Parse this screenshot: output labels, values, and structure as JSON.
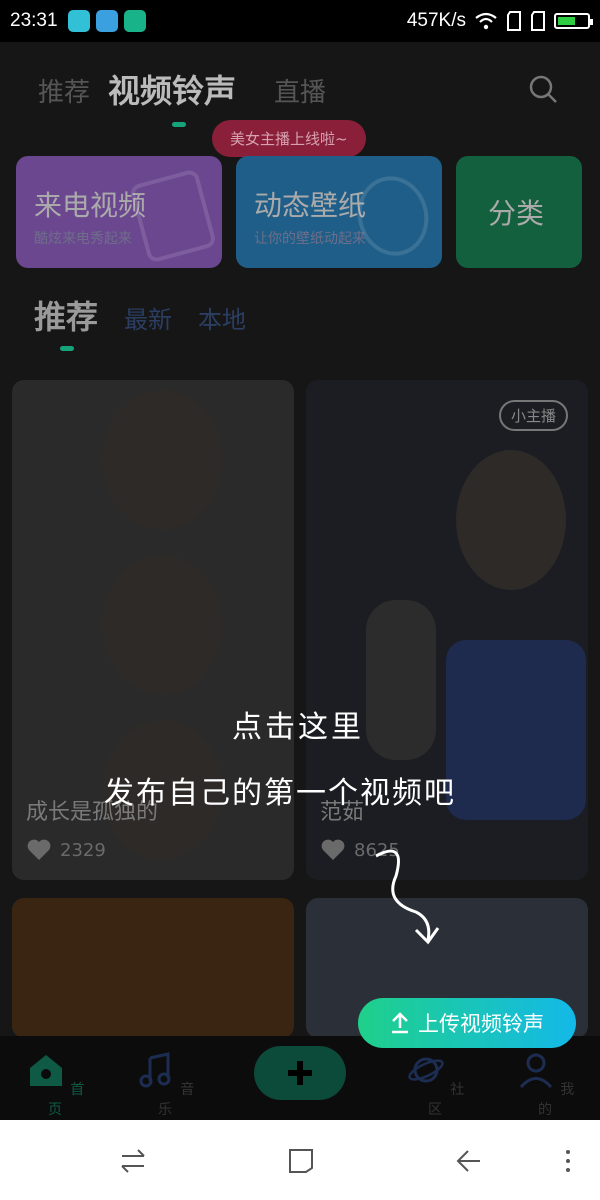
{
  "status_bar": {
    "time": "23:31",
    "network_speed": "457K/s",
    "battery_level": 0.6
  },
  "top_nav": {
    "tabs": [
      "推荐",
      "视频铃声",
      "直播"
    ],
    "active_tab": "视频铃声",
    "tooltip": "美女主播上线啦~"
  },
  "feature_cards": [
    {
      "title": "来电视频",
      "subtitle": "酷炫来电秀起来",
      "color": "#a06ad6"
    },
    {
      "title": "动态壁纸",
      "subtitle": "让你的壁纸动起来",
      "color": "#2a96d8"
    },
    {
      "title": "分类",
      "subtitle": "",
      "color": "#1ea36e"
    }
  ],
  "sub_tabs": [
    "推荐",
    "最新",
    "本地"
  ],
  "videos": [
    {
      "title": "成长是孤独的",
      "likes": "2329",
      "badge": ""
    },
    {
      "title": "范茹",
      "likes": "8625",
      "badge": "小主播"
    }
  ],
  "guide": {
    "line1": "点击这里",
    "line2": "发布自己的第一个视频吧"
  },
  "upload_button": "上传视频铃声",
  "bottom_nav": [
    "首页",
    "音乐",
    "社区",
    "我的"
  ],
  "colors": {
    "accent": "#16a37a",
    "upload_start": "#1fd08a",
    "upload_end": "#14b9e8"
  }
}
